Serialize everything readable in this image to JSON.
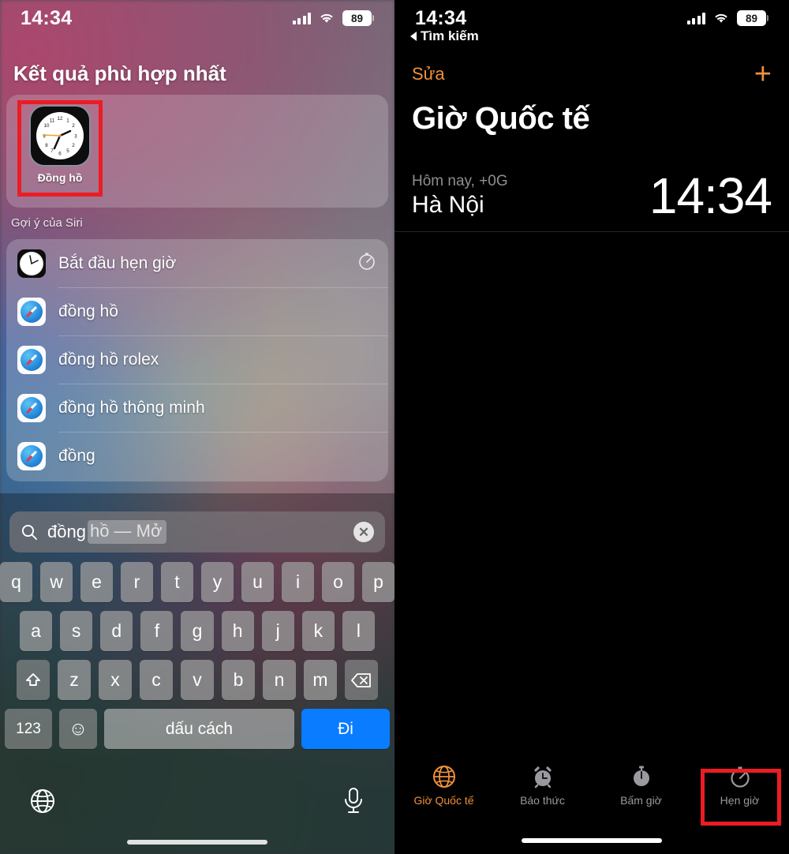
{
  "left_panel": {
    "status_bar": {
      "time": "14:34",
      "battery": "89",
      "signal_icon": "cellular-bars-icon",
      "wifi_icon": "wifi-icon"
    },
    "section_title": "Kết quả phù hợp nhất",
    "top_hit": {
      "app_name": "Đồng hồ",
      "icon": "clock-app-icon",
      "highlighted": true
    },
    "siri_label": "Gợi ý của Siri",
    "suggestions": [
      {
        "label": "Bắt đầu hẹn giờ",
        "icon": "clock-app-icon",
        "trailing_icon": "timer-icon"
      },
      {
        "label": "đồng hồ",
        "icon": "safari-icon",
        "trailing_icon": ""
      },
      {
        "label": "đồng hồ rolex",
        "icon": "safari-icon",
        "trailing_icon": ""
      },
      {
        "label": "đồng hồ thông minh",
        "icon": "safari-icon",
        "trailing_icon": ""
      },
      {
        "label": "đồng",
        "icon": "safari-icon",
        "trailing_icon": ""
      }
    ],
    "search": {
      "icon": "search-icon",
      "typed": "đồng",
      "completion": "hồ — Mở",
      "clear_icon": "clear-circle-icon"
    },
    "keyboard": {
      "row1": [
        "q",
        "w",
        "e",
        "r",
        "t",
        "y",
        "u",
        "i",
        "o",
        "p"
      ],
      "row2": [
        "a",
        "s",
        "d",
        "f",
        "g",
        "h",
        "j",
        "k",
        "l"
      ],
      "row3": [
        "z",
        "x",
        "c",
        "v",
        "b",
        "n",
        "m"
      ],
      "shift_icon": "shift-icon",
      "backspace_icon": "backspace-icon",
      "numbers_key": "123",
      "emoji_key": "emoji-icon",
      "space_key": "dấu cách",
      "go_key": "Đi"
    },
    "bottom": {
      "globe_icon": "globe-icon",
      "mic_icon": "microphone-icon",
      "home_indicator": "home-indicator"
    }
  },
  "right_panel": {
    "status_bar": {
      "time": "14:34",
      "battery": "89",
      "signal_icon": "cellular-bars-icon",
      "wifi_icon": "wifi-icon"
    },
    "back_link": "Tìm kiếm",
    "nav": {
      "edit": "Sửa",
      "add_icon": "plus-icon"
    },
    "title": "Giờ Quốc tế",
    "clocks": [
      {
        "offset": "Hôm nay, +0G",
        "city": "Hà Nội",
        "time": "14:34"
      }
    ],
    "tabs": [
      {
        "label": "Giờ Quốc tế",
        "icon": "globe-icon",
        "active": true,
        "highlighted": false
      },
      {
        "label": "Báo thức",
        "icon": "alarm-clock-icon",
        "active": false,
        "highlighted": false
      },
      {
        "label": "Bấm giờ",
        "icon": "stopwatch-icon",
        "active": false,
        "highlighted": false
      },
      {
        "label": "Hẹn giờ",
        "icon": "timer-icon",
        "active": false,
        "highlighted": true
      }
    ],
    "home_indicator": "home-indicator"
  },
  "colors": {
    "accent_orange": "#f0913a",
    "highlight_red": "#ec1c23",
    "go_blue": "#0a7cff"
  }
}
